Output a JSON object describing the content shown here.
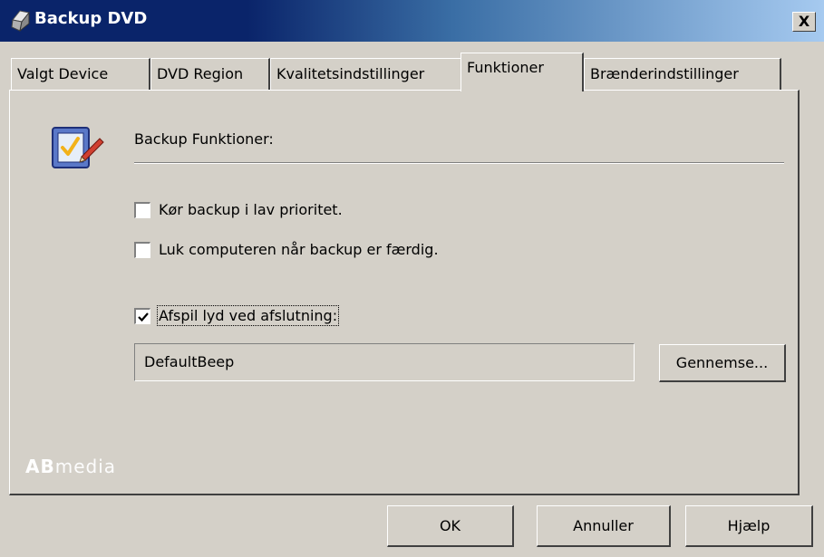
{
  "window": {
    "title": "Backup DVD",
    "close_label": "X"
  },
  "tabs": [
    {
      "label": "Valgt Device",
      "selected": false
    },
    {
      "label": "DVD Region",
      "selected": false
    },
    {
      "label": "Kvalitetsindstillinger",
      "selected": false
    },
    {
      "label": "Funktioner",
      "selected": true
    },
    {
      "label": "Brænderindstillinger",
      "selected": false
    }
  ],
  "panel": {
    "icon": "checklist-icon",
    "section_title": "Backup Funktioner:",
    "options": [
      {
        "label": "Kør backup i lav prioritet.",
        "checked": false
      },
      {
        "label": "Luk computeren når backup er færdig.",
        "checked": false
      },
      {
        "label": "Afspil lyd ved afslutning:",
        "checked": true
      }
    ],
    "sound_field_value": "DefaultBeep",
    "browse_label": "Gennemse..."
  },
  "brand": {
    "bold": "AB",
    "rest": "media"
  },
  "footer": {
    "ok_label": "OK",
    "cancel_label": "Annuller",
    "help_label": "Hjælp"
  },
  "colors": {
    "titlebar_start": "#0a246a",
    "titlebar_end": "#a6caf0",
    "face": "#d4d0c8"
  }
}
